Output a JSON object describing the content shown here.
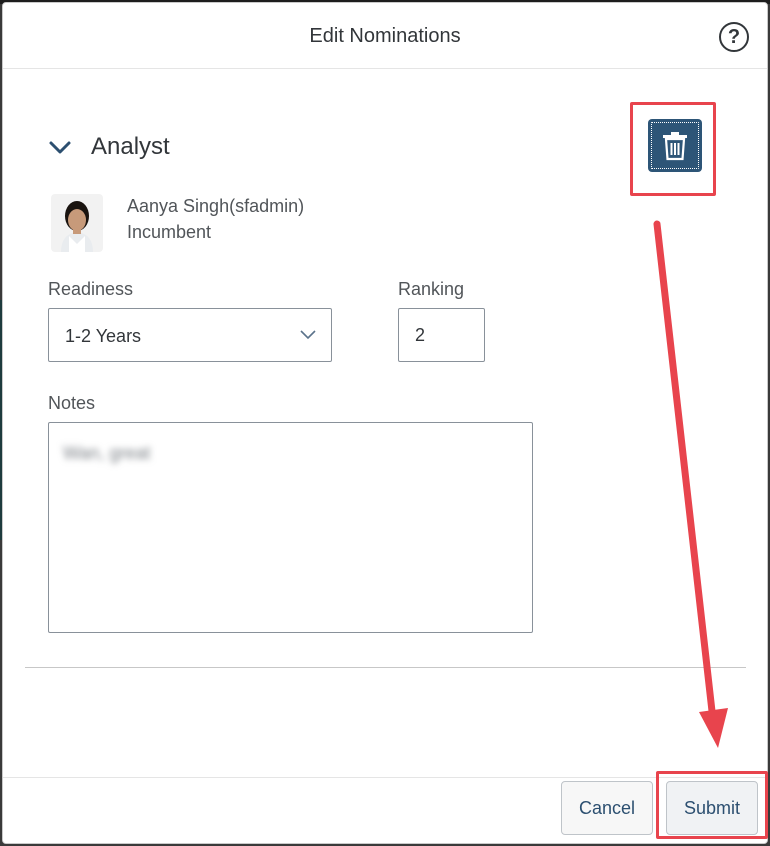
{
  "dialog": {
    "title": "Edit Nominations",
    "help_icon": "question-circle-icon"
  },
  "nomination": {
    "position_title": "Analyst",
    "person_name": "Aanya Singh(sfadmin)",
    "person_role": "Incumbent",
    "delete_icon": "trash-icon"
  },
  "form": {
    "readiness_label": "Readiness",
    "readiness_value": "1-2 Years",
    "ranking_label": "Ranking",
    "ranking_value": "2",
    "notes_label": "Notes",
    "notes_value": "Wan, great"
  },
  "footer": {
    "cancel_label": "Cancel",
    "submit_label": "Submit"
  },
  "colors": {
    "delete_button_bg": "#2d5577",
    "annotation_red": "#e8444d",
    "text": "#32363a"
  }
}
